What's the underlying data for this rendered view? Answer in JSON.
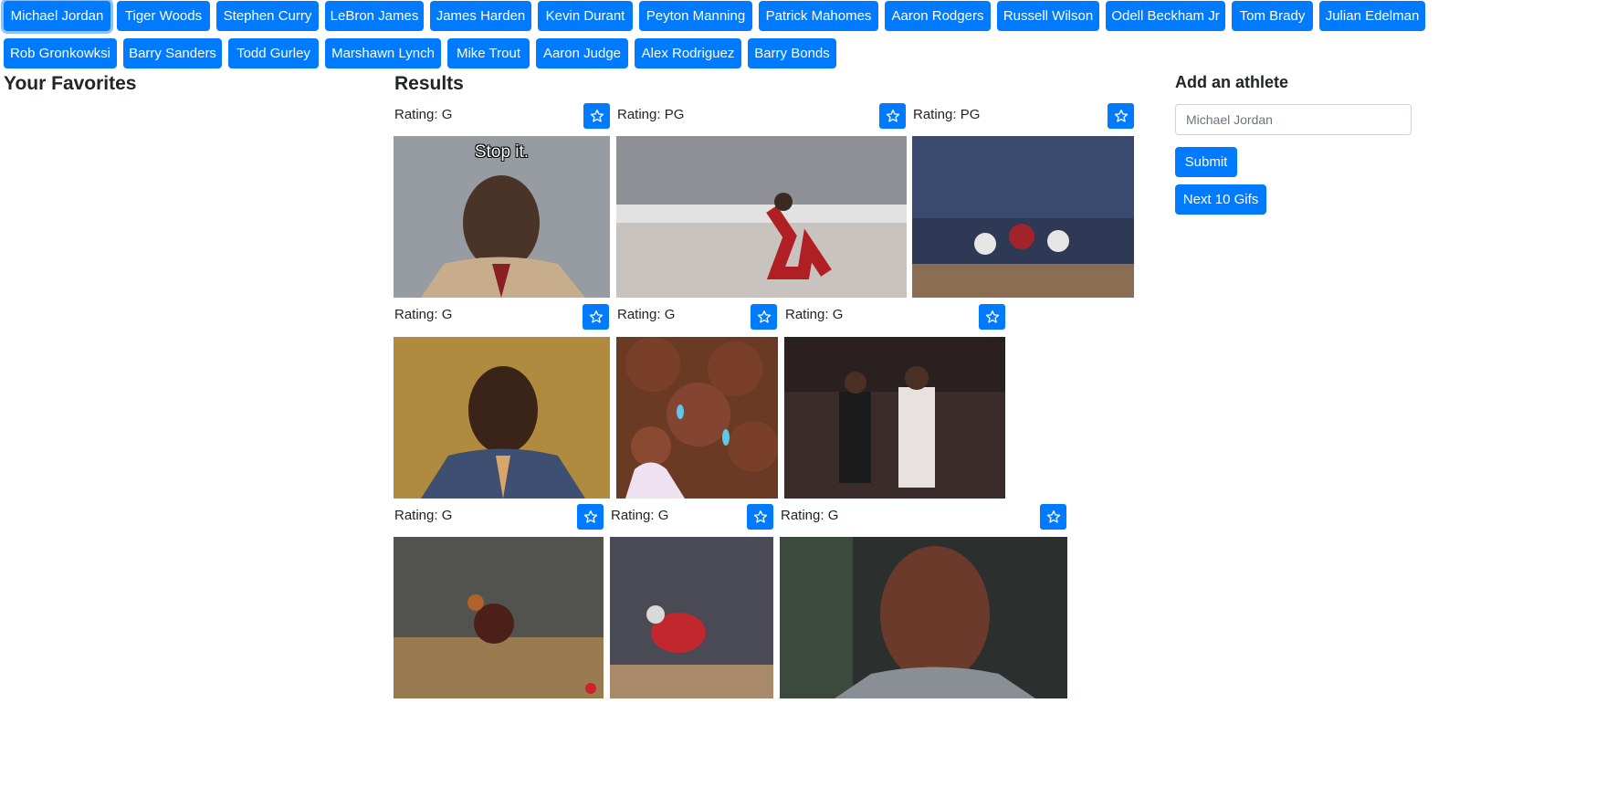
{
  "topics": [
    "Michael Jordan",
    "Tiger Woods",
    "Stephen Curry",
    "LeBron James",
    "James Harden",
    "Kevin Durant",
    "Peyton Manning",
    "Patrick Mahomes",
    "Aaron Rodgers",
    "Russell Wilson",
    "Odell Beckham Jr",
    "Tom Brady",
    "Julian Edelman",
    "Rob Gronkowksi",
    "Barry Sanders",
    "Todd Gurley",
    "Marshawn Lynch",
    "Mike Trout",
    "Aaron Judge",
    "Alex Rodriguez",
    "Barry Bonds"
  ],
  "favorites": {
    "title": "Your Favorites"
  },
  "results": {
    "title": "Results",
    "items": [
      {
        "rating": "Rating: G",
        "caption": "Stop it.",
        "icon": "star-outline-icon"
      },
      {
        "rating": "Rating: PG",
        "icon": "star-outline-icon"
      },
      {
        "rating": "Rating: PG",
        "icon": "star-outline-icon"
      },
      {
        "rating": "Rating: G",
        "icon": "star-outline-icon"
      },
      {
        "rating": "Rating: G",
        "icon": "star-outline-icon"
      },
      {
        "rating": "Rating: G",
        "icon": "star-outline-icon"
      },
      {
        "rating": "Rating: G",
        "icon": "star-outline-icon"
      },
      {
        "rating": "Rating: G",
        "icon": "star-outline-icon"
      },
      {
        "rating": "Rating: G",
        "icon": "star-outline-icon"
      }
    ]
  },
  "form": {
    "title": "Add an athlete",
    "placeholder": "Michael Jordan",
    "submit_label": "Submit",
    "next_label": "Next 10 Gifs"
  },
  "colors": {
    "primary": "#007bff",
    "text": "#212529"
  }
}
